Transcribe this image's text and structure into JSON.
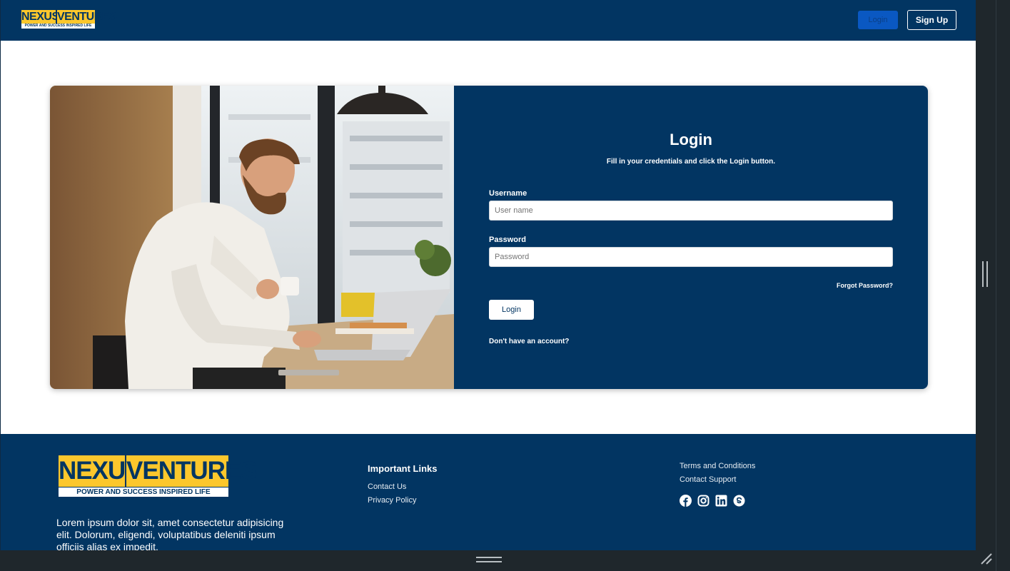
{
  "navbar": {
    "logo": {
      "word1": "NEXUS",
      "word2": "VENTURES",
      "tagline": "POWER AND SUCCESS INSPIRED LIFE"
    },
    "login_label": "Login",
    "signup_label": "Sign Up"
  },
  "login_form": {
    "title": "Login",
    "subtitle": "Fill in your credentials and click the Login button.",
    "username_label": "Username",
    "username_placeholder": "User name",
    "password_label": "Password",
    "password_placeholder": "Password",
    "forgot_label": "Forgot Password?",
    "submit_label": "Login",
    "no_account_label": "Don't have an account?"
  },
  "footer": {
    "logo": {
      "word1": "NEXUS",
      "word2": "VENTURES",
      "tagline": "POWER AND SUCCESS INSPIRED LIFE"
    },
    "about_text": "Lorem ipsum dolor sit, amet consectetur adipisicing elit. Dolorum, eligendi, voluptatibus deleniti ipsum officiis alias ex impedit.",
    "links_heading": "Important Links",
    "links": [
      "Contact Us",
      "Privacy Policy"
    ],
    "extra_links": [
      "Terms and Conditions",
      "Contact Support"
    ],
    "socials": [
      "facebook-icon",
      "instagram-icon",
      "linkedin-icon",
      "skype-icon"
    ]
  },
  "colors": {
    "brand_navy": "#023562",
    "brand_yellow": "#fcc72c",
    "nav_login_blue": "#0a58c2"
  }
}
